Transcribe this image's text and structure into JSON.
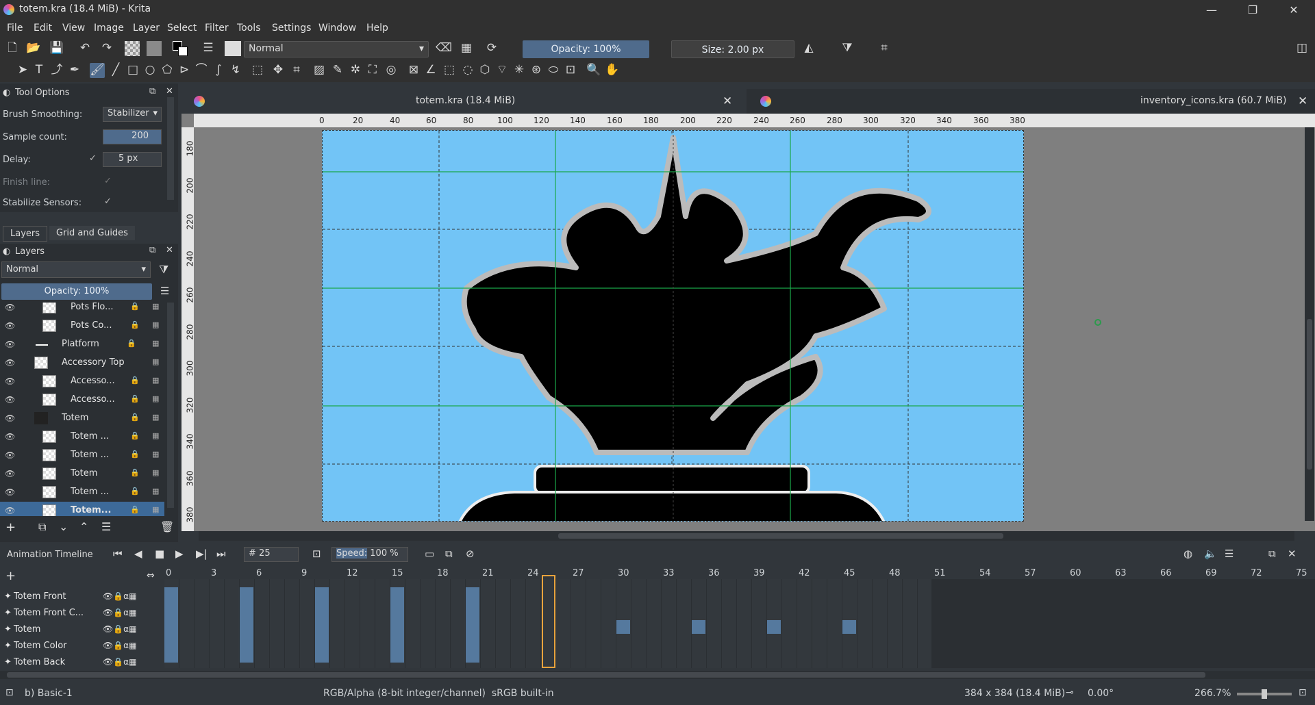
{
  "window": {
    "title": "totem.kra (18.4 MiB) - Krita",
    "min": "—",
    "max": "❐",
    "close": "✕"
  },
  "menu": [
    "File",
    "Edit",
    "View",
    "Image",
    "Layer",
    "Select",
    "Filter",
    "Tools",
    "Settings",
    "Window",
    "Help"
  ],
  "toolbar": {
    "blend_mode": "Normal",
    "opacity": "Opacity: 100%",
    "size": "Size: 2.00 px"
  },
  "tool_options": {
    "title": "Tool Options",
    "brush_smoothing_label": "Brush Smoothing:",
    "brush_smoothing_value": "Stabilizer",
    "sample_count_label": "Sample count:",
    "sample_count_value": "200",
    "delay_label": "Delay:",
    "delay_value": "5 px",
    "finish_line_label": "Finish line:",
    "stabilize_sensors_label": "Stabilize Sensors:"
  },
  "dock_tabs": [
    "Layers",
    "Grid and Guides"
  ],
  "layers": {
    "title": "Layers",
    "blend_mode": "Normal",
    "opacity": "Opacity:  100%",
    "items": [
      {
        "name": "Pots Flo..."
      },
      {
        "name": "Pots Co..."
      },
      {
        "name": "Platform"
      },
      {
        "name": "Accessory Top"
      },
      {
        "name": "Accesso..."
      },
      {
        "name": "Accesso..."
      },
      {
        "name": "Totem"
      },
      {
        "name": "Totem ..."
      },
      {
        "name": "Totem ..."
      },
      {
        "name": "Totem"
      },
      {
        "name": "Totem ..."
      },
      {
        "name": "Totem..."
      }
    ]
  },
  "doc_tabs": [
    {
      "title": "totem.kra (18.4 MiB)"
    },
    {
      "title": "inventory_icons.kra (60.7 MiB)"
    }
  ],
  "ruler_h": [
    "0",
    "20",
    "40",
    "60",
    "80",
    "100",
    "120",
    "140",
    "160",
    "180",
    "200",
    "220",
    "240",
    "260",
    "280",
    "300",
    "320",
    "340",
    "360",
    "380"
  ],
  "ruler_v": [
    "180",
    "200",
    "220",
    "240",
    "260",
    "280",
    "300",
    "320",
    "340",
    "360",
    "380"
  ],
  "timeline": {
    "title": "Animation Timeline",
    "frame": "25",
    "frame_prefix": "#",
    "speed_label": "Speed:",
    "speed_value": "100 %",
    "frame_ticks": [
      "0",
      "3",
      "6",
      "9",
      "12",
      "15",
      "18",
      "21",
      "24",
      "27",
      "30",
      "33",
      "36",
      "39",
      "42",
      "45",
      "48",
      "51",
      "54",
      "57",
      "60",
      "63",
      "66",
      "69",
      "72",
      "75"
    ],
    "tracks": [
      "Totem Front",
      "Totem Front C...",
      "Totem",
      "Totem Color",
      "Totem Back"
    ]
  },
  "status": {
    "brush": "b) Basic-1",
    "color": "RGB/Alpha (8-bit integer/channel)  sRGB built-in",
    "size": "384 x 384 (18.4 MiB)",
    "rotation": "0.00°",
    "zoom": "266.7%"
  }
}
